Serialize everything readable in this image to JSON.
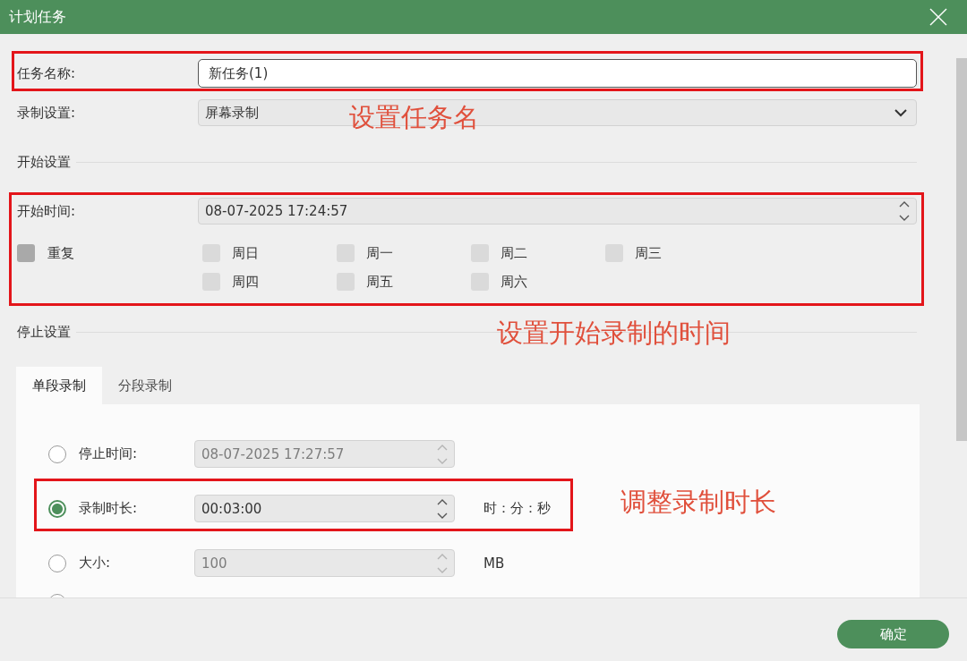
{
  "window": {
    "title": "计划任务"
  },
  "task_name": {
    "label": "任务名称:",
    "value": "新任务(1)",
    "highlighted": true,
    "note": "设置任务名"
  },
  "recording_setting": {
    "label": "录制设置:",
    "value": "屏幕录制"
  },
  "start_settings": {
    "title": "开始设置",
    "highlighted": true,
    "note": "设置开始录制的时间",
    "start_time": {
      "label": "开始时间:",
      "value": "08-07-2025 17:24:57"
    },
    "repeat": {
      "label": "重复",
      "checked": false,
      "disabled": false
    },
    "weekdays": [
      {
        "label": "周日",
        "checked": false,
        "disabled": true
      },
      {
        "label": "周一",
        "checked": false,
        "disabled": true
      },
      {
        "label": "周二",
        "checked": false,
        "disabled": true
      },
      {
        "label": "周三",
        "checked": false,
        "disabled": true
      },
      {
        "label": "周四",
        "checked": false,
        "disabled": true
      },
      {
        "label": "周五",
        "checked": false,
        "disabled": true
      },
      {
        "label": "周六",
        "checked": false,
        "disabled": true
      }
    ]
  },
  "stop_settings": {
    "title": "停止设置",
    "tabs": [
      {
        "label": "单段录制",
        "selected": true
      },
      {
        "label": "分段录制",
        "selected": false
      }
    ],
    "options": [
      {
        "kind": "spinner",
        "label": "停止时间:",
        "value": "08-07-2025 17:27:57",
        "selected": false,
        "disabled": true,
        "highlighted": false
      },
      {
        "kind": "spinner",
        "label": "录制时长:",
        "value": "00:03:00",
        "unit": "时：分：秒",
        "selected": true,
        "disabled": false,
        "highlighted": true,
        "note": "调整录制时长"
      },
      {
        "kind": "spinner",
        "label": "大小:",
        "value": "100",
        "unit": "MB",
        "selected": false,
        "disabled": true,
        "highlighted": false
      },
      {
        "kind": "plain",
        "selected": false,
        "highlighted": false
      }
    ]
  },
  "buttons": [
    {
      "label": "确定"
    }
  ]
}
